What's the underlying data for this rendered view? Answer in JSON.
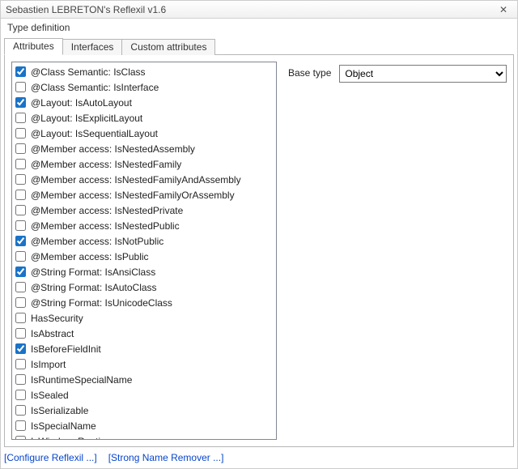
{
  "window": {
    "title": "Sebastien LEBRETON's Reflexil v1.6",
    "close_glyph": "✕"
  },
  "subtitle": "Type definition",
  "tabs": [
    {
      "label": "Attributes",
      "active": true
    },
    {
      "label": "Interfaces",
      "active": false
    },
    {
      "label": "Custom attributes",
      "active": false
    }
  ],
  "baseType": {
    "label": "Base type",
    "value": "Object",
    "options": [
      "Object"
    ]
  },
  "attributes": [
    {
      "label": "@Class Semantic: IsClass",
      "checked": true
    },
    {
      "label": "@Class Semantic: IsInterface",
      "checked": false
    },
    {
      "label": "@Layout: IsAutoLayout",
      "checked": true
    },
    {
      "label": "@Layout: IsExplicitLayout",
      "checked": false
    },
    {
      "label": "@Layout: IsSequentialLayout",
      "checked": false
    },
    {
      "label": "@Member access: IsNestedAssembly",
      "checked": false
    },
    {
      "label": "@Member access: IsNestedFamily",
      "checked": false
    },
    {
      "label": "@Member access: IsNestedFamilyAndAssembly",
      "checked": false
    },
    {
      "label": "@Member access: IsNestedFamilyOrAssembly",
      "checked": false
    },
    {
      "label": "@Member access: IsNestedPrivate",
      "checked": false
    },
    {
      "label": "@Member access: IsNestedPublic",
      "checked": false
    },
    {
      "label": "@Member access: IsNotPublic",
      "checked": true
    },
    {
      "label": "@Member access: IsPublic",
      "checked": false
    },
    {
      "label": "@String Format: IsAnsiClass",
      "checked": true
    },
    {
      "label": "@String Format: IsAutoClass",
      "checked": false
    },
    {
      "label": "@String Format: IsUnicodeClass",
      "checked": false
    },
    {
      "label": "HasSecurity",
      "checked": false
    },
    {
      "label": "IsAbstract",
      "checked": false
    },
    {
      "label": "IsBeforeFieldInit",
      "checked": true
    },
    {
      "label": "IsImport",
      "checked": false
    },
    {
      "label": "IsRuntimeSpecialName",
      "checked": false
    },
    {
      "label": "IsSealed",
      "checked": false
    },
    {
      "label": "IsSerializable",
      "checked": false
    },
    {
      "label": "IsSpecialName",
      "checked": false
    },
    {
      "label": "IsWindowsRuntime",
      "checked": false
    }
  ],
  "footer": {
    "configure": "[Configure Reflexil ...]",
    "strongName": "[Strong Name Remover ...]"
  }
}
